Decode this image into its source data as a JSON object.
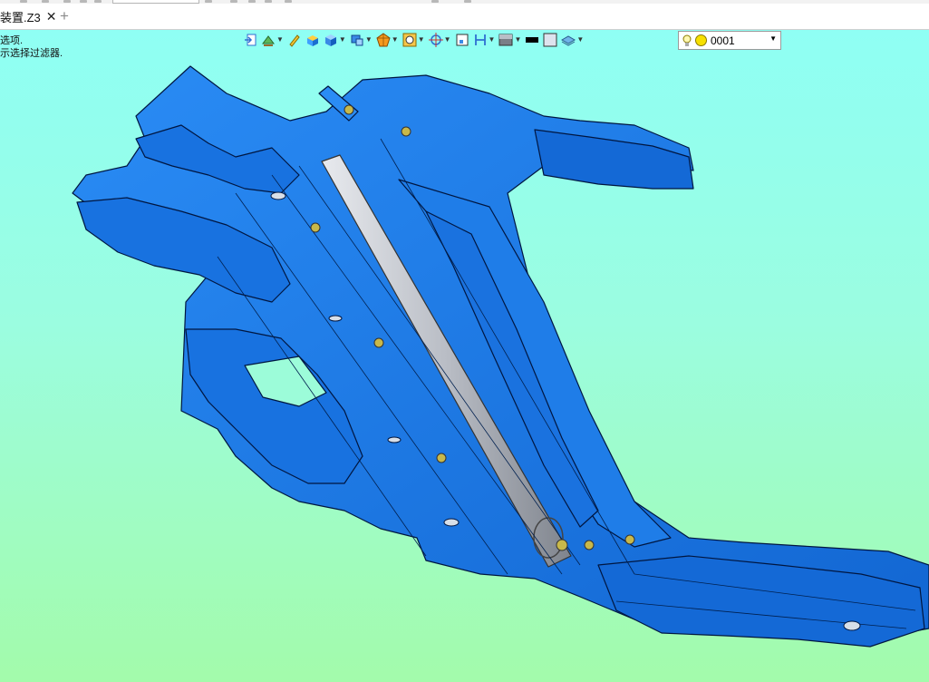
{
  "document_tab": {
    "title": "装置.Z3",
    "close_icon": "close-icon"
  },
  "new_tab_label": "+",
  "prompt": {
    "line1": "选项.",
    "line2": "示选择过滤器."
  },
  "toolbar_items": [
    "exit-icon",
    "render-mode-icon",
    "highlight-icon",
    "shaded-icon",
    "cube-view-icon",
    "display-mode-icon",
    "explode-icon",
    "zoom-fit-icon",
    "orbit-icon",
    "window-icon",
    "section-icon",
    "background-icon",
    "line-color-icon",
    "face-color-icon",
    "layer-icon"
  ],
  "layer_selector": {
    "value": "0001"
  },
  "colors": {
    "part": "#1677e6",
    "part_dark": "#0b4ea8",
    "outline": "#001640",
    "tube": "#b8bcc4",
    "viewport_top": "#8ffff4",
    "viewport_bottom": "#a3fbab"
  }
}
